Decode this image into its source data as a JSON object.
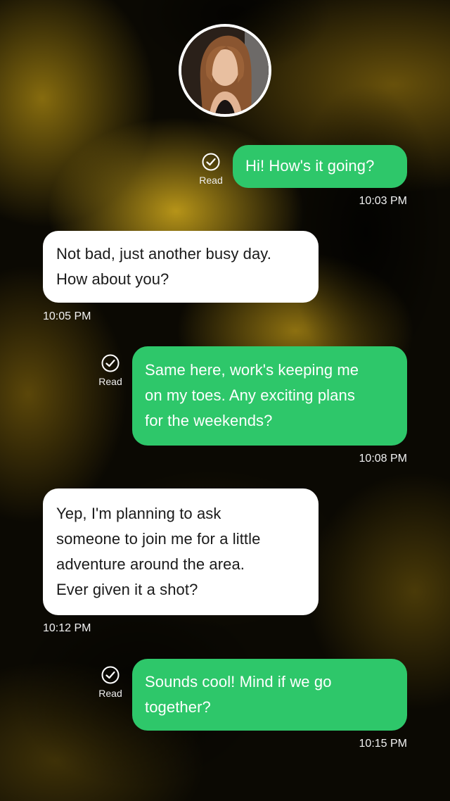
{
  "contact": {
    "avatar_icon": "profile-photo"
  },
  "messages": [
    {
      "direction": "outgoing",
      "lines": [
        "Hi! How's it going?"
      ],
      "time": "10:03 PM",
      "status": "Read"
    },
    {
      "direction": "incoming",
      "lines": [
        "Not bad, just another busy day.",
        "How about you?"
      ],
      "time": "10:05 PM"
    },
    {
      "direction": "outgoing",
      "lines": [
        "Same here, work's keeping me",
        "on my toes. Any exciting plans",
        "for the weekends?"
      ],
      "time": "10:08 PM",
      "status": "Read"
    },
    {
      "direction": "incoming",
      "lines": [
        "Yep, I'm planning to ask",
        "someone to join me for a little",
        "adventure around the area.",
        "Ever given it a shot?"
      ],
      "time": "10:12 PM"
    },
    {
      "direction": "outgoing",
      "lines": [
        "Sounds cool! Mind if we go",
        "together?"
      ],
      "time": "10:15 PM",
      "status": "Read"
    }
  ],
  "colors": {
    "outgoing_bubble": "#2ec76a",
    "incoming_bubble": "#ffffff",
    "background_tint": "#c9a11a"
  }
}
